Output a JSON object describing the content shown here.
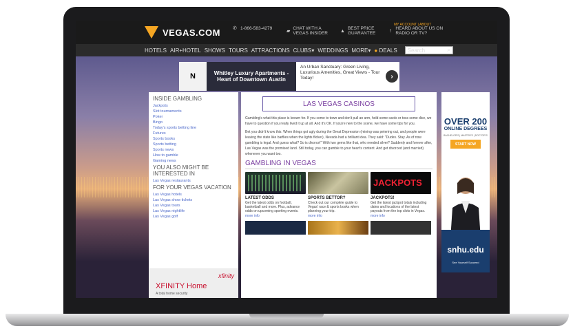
{
  "header": {
    "logo": "VEGAS.COM",
    "phone": "1-866-583-4279",
    "chat": "CHAT WITH A VEGAS INSIDER",
    "price": "BEST PRICE GUARANTEE",
    "radio": "HEARD ABOUT US ON RADIO OR TV?",
    "account": "MY ACCOUNT  |  ABOUT"
  },
  "nav": {
    "items": [
      "HOTELS",
      "AIR+HOTEL",
      "SHOWS",
      "TOURS",
      "ATTRACTIONS",
      "CLUBS▾",
      "WEDDINGS",
      "MORE▾"
    ],
    "deals": "DEALS",
    "search_placeholder": "Search"
  },
  "top_ad": {
    "logo": "N",
    "headline": "Whitley Luxury Apartments - Heart of Downtown Austin",
    "body": "An Urban Sanctuary: Green Living, Luxurious Amenities, Great Views - Tour Today!",
    "arrow": "›"
  },
  "sidebar": {
    "heading": "INSIDE GAMBLING",
    "links": [
      "Jackpots",
      "Slot tournaments",
      "Poker",
      "Bingo",
      "Today's sports betting line",
      "Futures",
      "Sports books",
      "Sports betting",
      "Sports news",
      "How to gamble",
      "Gaming news"
    ],
    "heading2": "YOU ALSO MIGHT BE INTERESTED IN",
    "links2": [
      "Las Vegas restaurants"
    ],
    "heading3": "FOR YOUR VEGAS VACATION",
    "links3": [
      "Las Vegas hotels",
      "Las Vegas show tickets",
      "Las Vegas tours",
      "Las Vegas nightlife",
      "Las Vegas golf"
    ]
  },
  "xfinity_ad": {
    "logo": "xfinity",
    "headline": "XFINITY Home",
    "sub": "A total home security"
  },
  "main": {
    "title": "LAS VEGAS CASINOS",
    "p1": "Gambling's what this place is known for. If you come to town and don't pull an arm, hold some cards or toss some dice, we have to question if you really lived it up at all. And it's OK. If you're new to the scene, we have some tips for you.",
    "p2": "Bet you didn't know this: When things got ugly during the Great Depression (mining was petering out, and people were leaving the state like barflies when the lights flicker), Nevada had a brilliant idea. They said: \"Dudes. Stay. As of now gambling is legal. And guess what? So is divorce!\" With two gems like that, who needed silver? Suddenly and forever after, Las Vegas was the promised land. Still today, you can gamble to your heart's content. And get divorced (and married) whenever you want too.",
    "subtitle": "GAMBLING IN VEGAS",
    "cards": [
      {
        "title": "LATEST ODDS",
        "text": "Get the latest odds on football, basketball and more. Plus, advance odds on upcoming sporting events.",
        "more": "more info"
      },
      {
        "title": "SPORTS BETTOR?",
        "text": "Check out our complete guide to Vegas' race & sports books when planning your trip.",
        "more": "more info"
      },
      {
        "title": "JACKPOTS!",
        "text": "Get the latest jackpot totals including dates and locations of the latest payouts from the top slots in Vegas.",
        "more": "more info"
      }
    ],
    "jackpot_img_text": "JACKPOTS"
  },
  "right_ad": {
    "big": "OVER 200",
    "deg": "ONLINE DEGREES",
    "tags": "BACHELOR'S | MASTER'S | DOCTOR'S",
    "btn": "START NOW",
    "brand": "snhu.edu",
    "tagline": "See Yourself Succeed"
  }
}
